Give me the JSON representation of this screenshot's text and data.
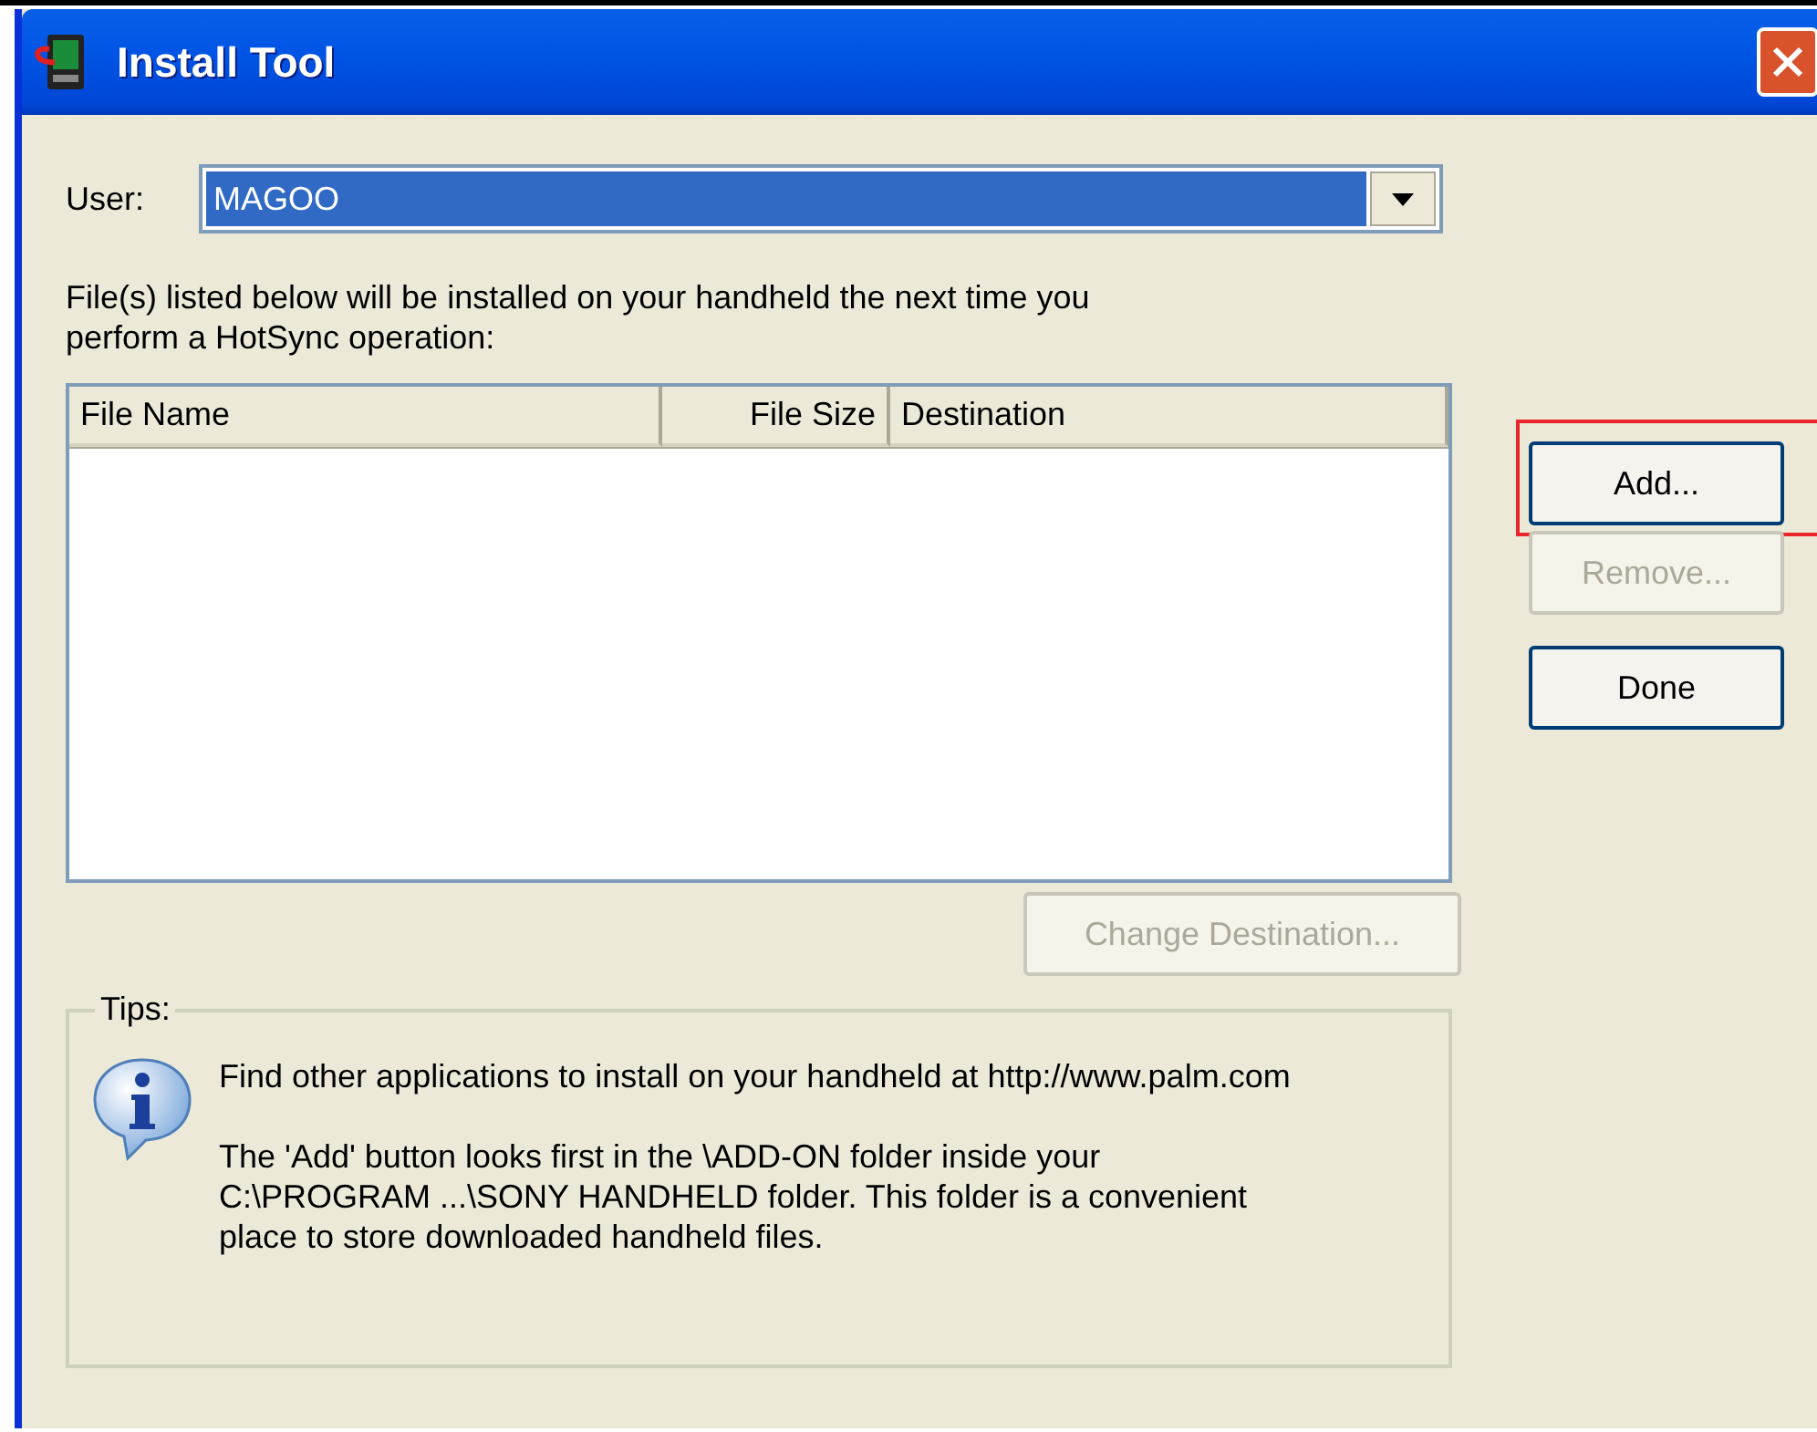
{
  "window": {
    "title": "Install Tool"
  },
  "user": {
    "label": "User:",
    "value": "MAGOO",
    "selected": true
  },
  "instructions": "File(s) listed below will be installed on your handheld the next time you perform a HotSync operation:",
  "file_list": {
    "columns": [
      {
        "label": "File Name",
        "kind": "text"
      },
      {
        "label": "File Size",
        "kind": "size"
      },
      {
        "label": "Destination",
        "kind": "text"
      }
    ]
  },
  "buttons": [
    {
      "label": "Add...",
      "disabled": false,
      "highlighted": true
    },
    {
      "label": "Remove...",
      "disabled": true,
      "highlighted": false
    },
    {
      "label": "Done",
      "disabled": false,
      "highlighted": false
    }
  ],
  "change_destination": {
    "label": "Change Destination...",
    "disabled": true
  },
  "tips": {
    "title": "Tips:",
    "paragraphs": [
      "Find other applications to install on your handheld at http://www.palm.com",
      "The 'Add' button looks first in the \\ADD-ON folder inside your C:\\PROGRAM ...\\SONY HANDHELD folder. This folder is a convenient place to store downloaded handheld files."
    ]
  }
}
